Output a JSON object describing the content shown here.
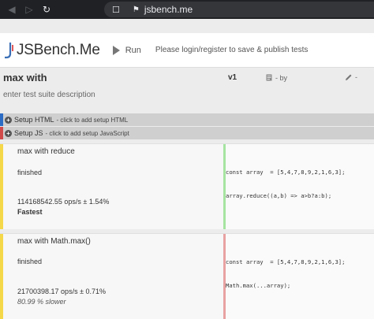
{
  "browser": {
    "url": "jsbench.me",
    "back_icon": "back-arrow-icon",
    "forward_icon": "forward-arrow-icon",
    "reload_icon": "reload-icon",
    "bookmark_icon": "bookmark-icon",
    "lock_icon": "lock-icon"
  },
  "header": {
    "logo_text": "JSBench.Me",
    "run_label": "Run",
    "login_note": "Please login/register to save & publish tests"
  },
  "suite": {
    "title": "max with",
    "version": "v1",
    "byline": "- by",
    "edit_dash": "-",
    "description_placeholder": "enter test suite description"
  },
  "setup": {
    "html_label": "Setup HTML",
    "html_hint": "- click to add setup HTML",
    "js_label": "Setup JS",
    "js_hint": "- click to add setup JavaScript"
  },
  "cases": [
    {
      "title": "max with reduce",
      "status": "finished",
      "ops": "114168542.55 ops/s ± 1.54%",
      "verdict": "Fastest",
      "code_line1": "const array  = [5,4,7,8,9,2,1,6,3];",
      "code_line2": "array.reduce((a,b) => a>b?a:b);"
    },
    {
      "title": "max with Math.max()",
      "status": "finished",
      "ops": "21700398.17 ops/s ± 0.71%",
      "verdict": "80.99 % slower",
      "code_line1": "const array  = [5,4,7,8,9,2,1,6,3];",
      "code_line2": "Math.max(...array);"
    }
  ],
  "colors": {
    "setup_html_accent": "#2c6cc4",
    "setup_js_accent": "#d14b4b",
    "case_accent": "#f5d74a",
    "fastest_code_bar": "#a6e4a0",
    "slower_code_bar": "#e8a2a2"
  }
}
